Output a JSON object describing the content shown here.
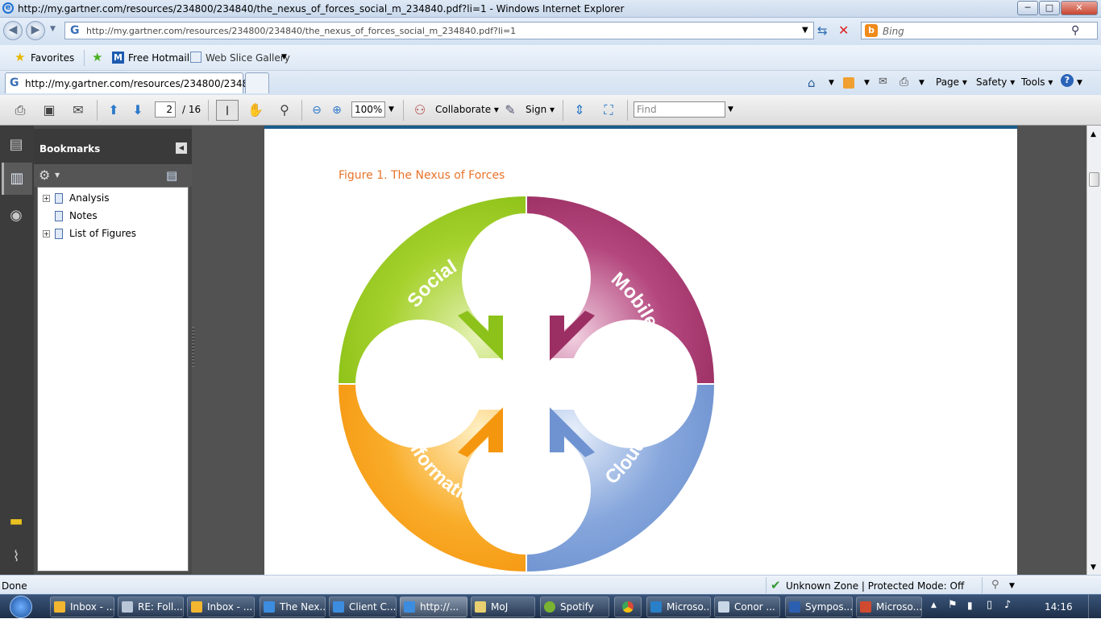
{
  "window": {
    "title": "http://my.gartner.com/resources/234800/234840/the_nexus_of_forces_social_m_234840.pdf?li=1 - Windows Internet Explorer",
    "min_label": "─",
    "max_label": "□",
    "close_label": "✕"
  },
  "addressbar": {
    "url": "http://my.gartner.com/resources/234800/234840/the_nexus_of_forces_social_m_234840.pdf?li=1",
    "search_placeholder": "Bing"
  },
  "favorites": {
    "favorites_label": "Favorites",
    "hotmail_label": "Free Hotmail",
    "webslice_label": "Web Slice Gallery"
  },
  "tabs": {
    "active_tab": "http://my.gartner.com/resources/234800/234840...",
    "commands": [
      "Page",
      "Safety",
      "Tools"
    ]
  },
  "acrobat": {
    "page_current": "2",
    "page_total": "/ 16",
    "zoom": "100%",
    "collaborate": "Collaborate",
    "sign": "Sign",
    "find_placeholder": "Find"
  },
  "bookmarks": {
    "header": "Bookmarks",
    "items": [
      "Analysis",
      "Notes",
      "List of Figures"
    ]
  },
  "document": {
    "figure_title": "Figure 1. The Nexus of Forces",
    "segments": [
      {
        "label": "Social",
        "color": "#8cc21a"
      },
      {
        "label": "Mobile",
        "color": "#9b2f63"
      },
      {
        "label": "Cloud",
        "color": "#6f93d1"
      },
      {
        "label": "Information",
        "color": "#f5960f"
      }
    ]
  },
  "status": {
    "left": "Done",
    "zone": "Unknown Zone | Protected Mode: Off"
  },
  "taskbar": {
    "items": [
      "Inbox - ...",
      "RE: Foll...",
      "Inbox - ...",
      "The Nex...",
      "Client C...",
      "http://...",
      "MoJ",
      "Spotify",
      "",
      "Microso...",
      "Conor ...",
      "Sympos...",
      "Microso..."
    ],
    "clock": "14:16"
  }
}
